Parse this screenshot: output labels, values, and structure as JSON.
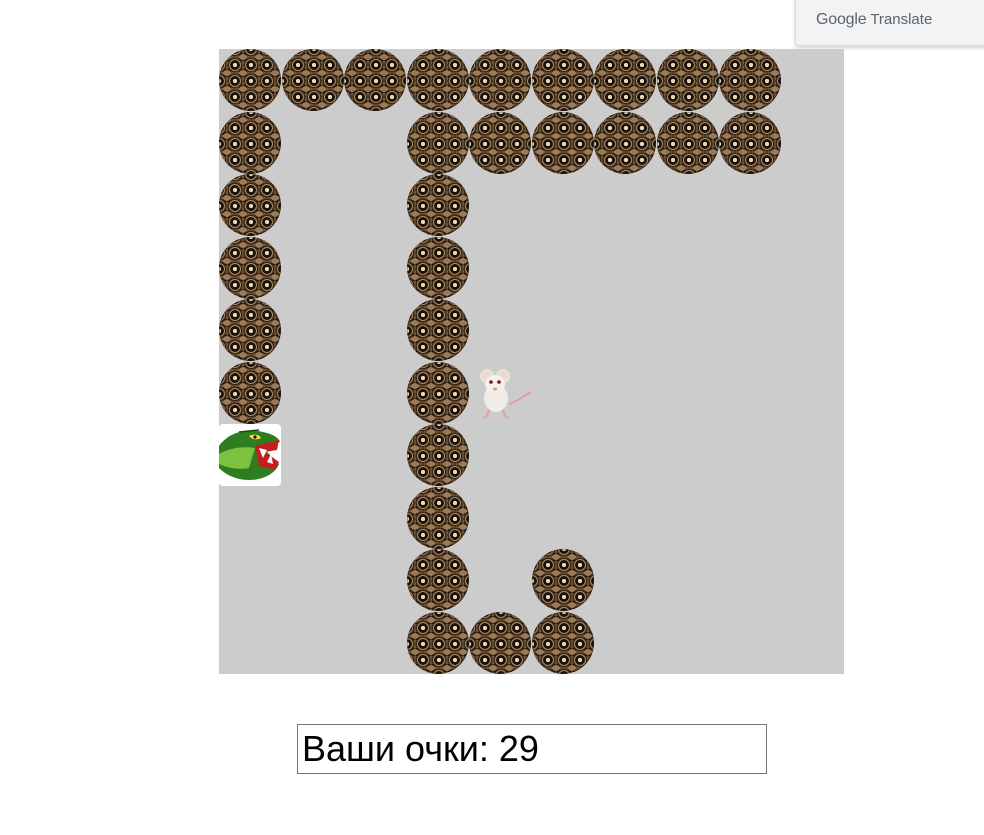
{
  "translate_popup": {
    "brand": "Google",
    "product": "Translate"
  },
  "game": {
    "grid_size": 10,
    "board_color": "#cccccc",
    "head": [
      0,
      6
    ],
    "direction": "right",
    "body": [
      [
        0,
        5
      ],
      [
        0,
        4
      ],
      [
        0,
        3
      ],
      [
        0,
        2
      ],
      [
        0,
        1
      ],
      [
        0,
        0
      ],
      [
        1,
        0
      ],
      [
        2,
        0
      ],
      [
        3,
        0
      ],
      [
        4,
        0
      ],
      [
        5,
        0
      ],
      [
        6,
        0
      ],
      [
        7,
        0
      ],
      [
        8,
        0
      ],
      [
        8,
        1
      ],
      [
        7,
        1
      ],
      [
        6,
        1
      ],
      [
        5,
        1
      ],
      [
        4,
        1
      ],
      [
        3,
        1
      ],
      [
        3,
        2
      ],
      [
        3,
        3
      ],
      [
        3,
        4
      ],
      [
        3,
        5
      ],
      [
        3,
        6
      ],
      [
        3,
        7
      ],
      [
        3,
        8
      ],
      [
        3,
        9
      ],
      [
        4,
        9
      ],
      [
        5,
        9
      ],
      [
        5,
        8
      ]
    ],
    "food": [
      4,
      5
    ],
    "food_icon": "mouse-icon",
    "head_icon": "snake-head-icon"
  },
  "score": {
    "label": "Ваши очки:",
    "value": 29,
    "text": "Ваши очки: 29"
  }
}
